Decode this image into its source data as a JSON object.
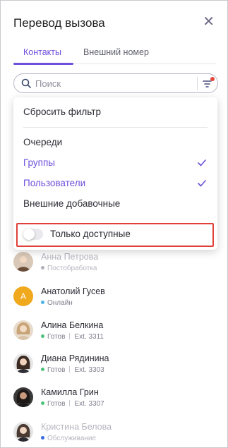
{
  "header": {
    "title": "Перевод вызова",
    "close_symbol": "✕"
  },
  "tabs": [
    {
      "label": "Контакты",
      "active": true
    },
    {
      "label": "Внешний номер",
      "active": false
    }
  ],
  "search": {
    "placeholder": "Поиск",
    "value": ""
  },
  "dropdown": {
    "reset_label": "Сбросить фильтр",
    "options": [
      {
        "label": "Очереди",
        "selected": false
      },
      {
        "label": "Группы",
        "selected": true
      },
      {
        "label": "Пользователи",
        "selected": true
      },
      {
        "label": "Внешние добавочные",
        "selected": false
      }
    ],
    "toggle": {
      "label": "Только доступные",
      "on": false
    }
  },
  "contacts": [
    {
      "name": "Анна Петрова",
      "status": "Постобработка",
      "ext": "",
      "status_color": "#9a9aa6",
      "avatar": "photo",
      "dim": true
    },
    {
      "name": "Анатолий Гусев",
      "status": "Онлайн",
      "ext": "",
      "status_color": "#4fb3e8",
      "avatar": "letter",
      "letter": "А",
      "dim": false
    },
    {
      "name": "Алина Белкина",
      "status": "Готов",
      "ext": "Ext. 3311",
      "status_color": "#4cc27a",
      "avatar": "photo",
      "dim": false
    },
    {
      "name": "Диана Рядинина",
      "status": "Готов",
      "ext": "Ext. 3303",
      "status_color": "#4cc27a",
      "avatar": "photo",
      "dim": false
    },
    {
      "name": "Камилла Грин",
      "status": "Готов",
      "ext": "Ext. 3307",
      "status_color": "#4cc27a",
      "avatar": "photo",
      "dim": false
    },
    {
      "name": "Кристина Белова",
      "status": "Обслуживание",
      "ext": "",
      "status_color": "#3a6ee8",
      "avatar": "photo",
      "dim": true
    }
  ],
  "colors": {
    "accent": "#6e4fdb",
    "highlight": "#e0403a",
    "notification_dot": "#e2473a"
  }
}
